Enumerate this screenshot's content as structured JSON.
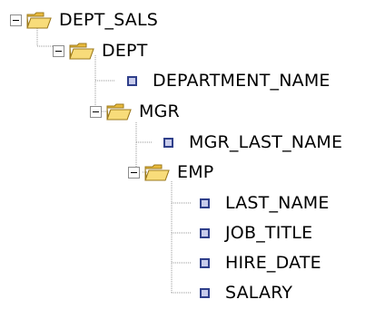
{
  "tree": {
    "root": {
      "label": "DEPT_SALS",
      "expanded": true,
      "icon": "folder-open-icon",
      "children": {
        "dept": {
          "label": "DEPT",
          "expanded": true,
          "icon": "folder-open-icon",
          "children": {
            "department_name": {
              "label": "DEPARTMENT_NAME",
              "icon": "leaf-node-icon"
            },
            "mgr": {
              "label": "MGR",
              "expanded": true,
              "icon": "folder-open-icon",
              "children": {
                "mgr_last_name": {
                  "label": "MGR_LAST_NAME",
                  "icon": "leaf-node-icon"
                },
                "emp": {
                  "label": "EMP",
                  "expanded": true,
                  "icon": "folder-open-icon",
                  "children": {
                    "last_name": {
                      "label": "LAST_NAME",
                      "icon": "leaf-node-icon"
                    },
                    "job_title": {
                      "label": "JOB_TITLE",
                      "icon": "leaf-node-icon"
                    },
                    "hire_date": {
                      "label": "HIRE_DATE",
                      "icon": "leaf-node-icon"
                    },
                    "salary": {
                      "label": "SALARY",
                      "icon": "leaf-node-icon"
                    }
                  }
                }
              }
            }
          }
        }
      }
    }
  },
  "colors": {
    "folder_fill": "#f4cf5a",
    "folder_outline": "#9c7a1c",
    "leaf_border": "#2f3f8a",
    "leaf_fill": "#c8ccec",
    "guide_lines": "#9a9a9a"
  }
}
